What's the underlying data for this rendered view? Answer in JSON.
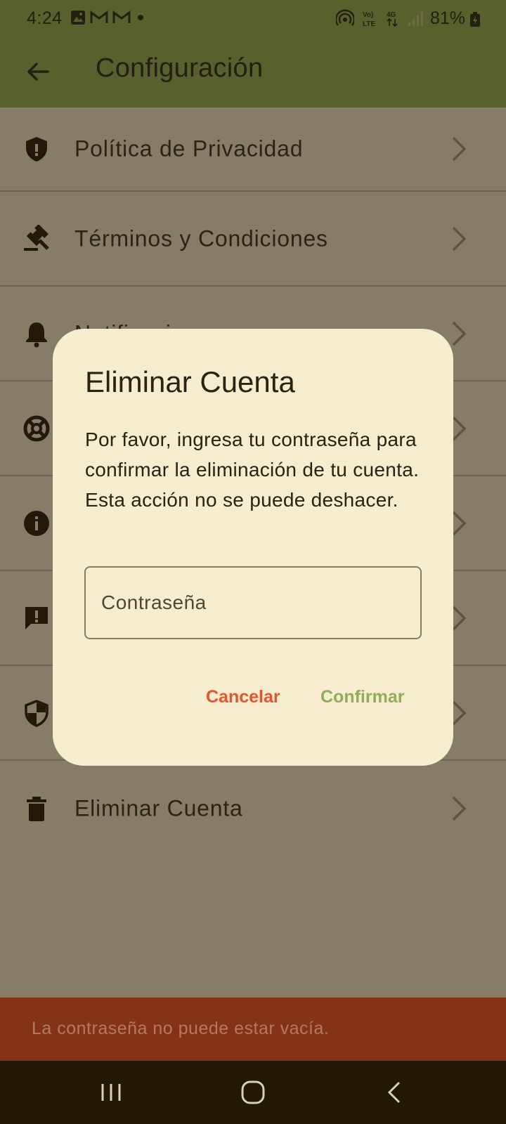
{
  "status_bar": {
    "time": "4:24",
    "battery": "81%"
  },
  "app_bar": {
    "title": "Configuración"
  },
  "settings": {
    "items": [
      {
        "label": "Política de Privacidad"
      },
      {
        "label": "Términos y Condiciones"
      },
      {
        "label": "Notificaciones"
      },
      {
        "label": ""
      },
      {
        "label": ""
      },
      {
        "label": ""
      },
      {
        "label": ""
      },
      {
        "label": "Eliminar Cuenta"
      }
    ]
  },
  "dialog": {
    "title": "Eliminar Cuenta",
    "message": "Por favor, ingresa tu contraseña para confirmar la eliminación de tu cuenta. Esta acción no se puede deshacer.",
    "password_placeholder": "Contraseña",
    "cancel_label": "Cancelar",
    "confirm_label": "Confirmar"
  },
  "snackbar": {
    "message": "La contraseña no puede estar vacía."
  },
  "colors": {
    "app_bar": "#58602e",
    "scrim_background": "#877c68",
    "dialog_background": "#f7ecce",
    "cancel": "#e2552f",
    "confirm": "#8fad5a",
    "snackbar": "#843316"
  }
}
